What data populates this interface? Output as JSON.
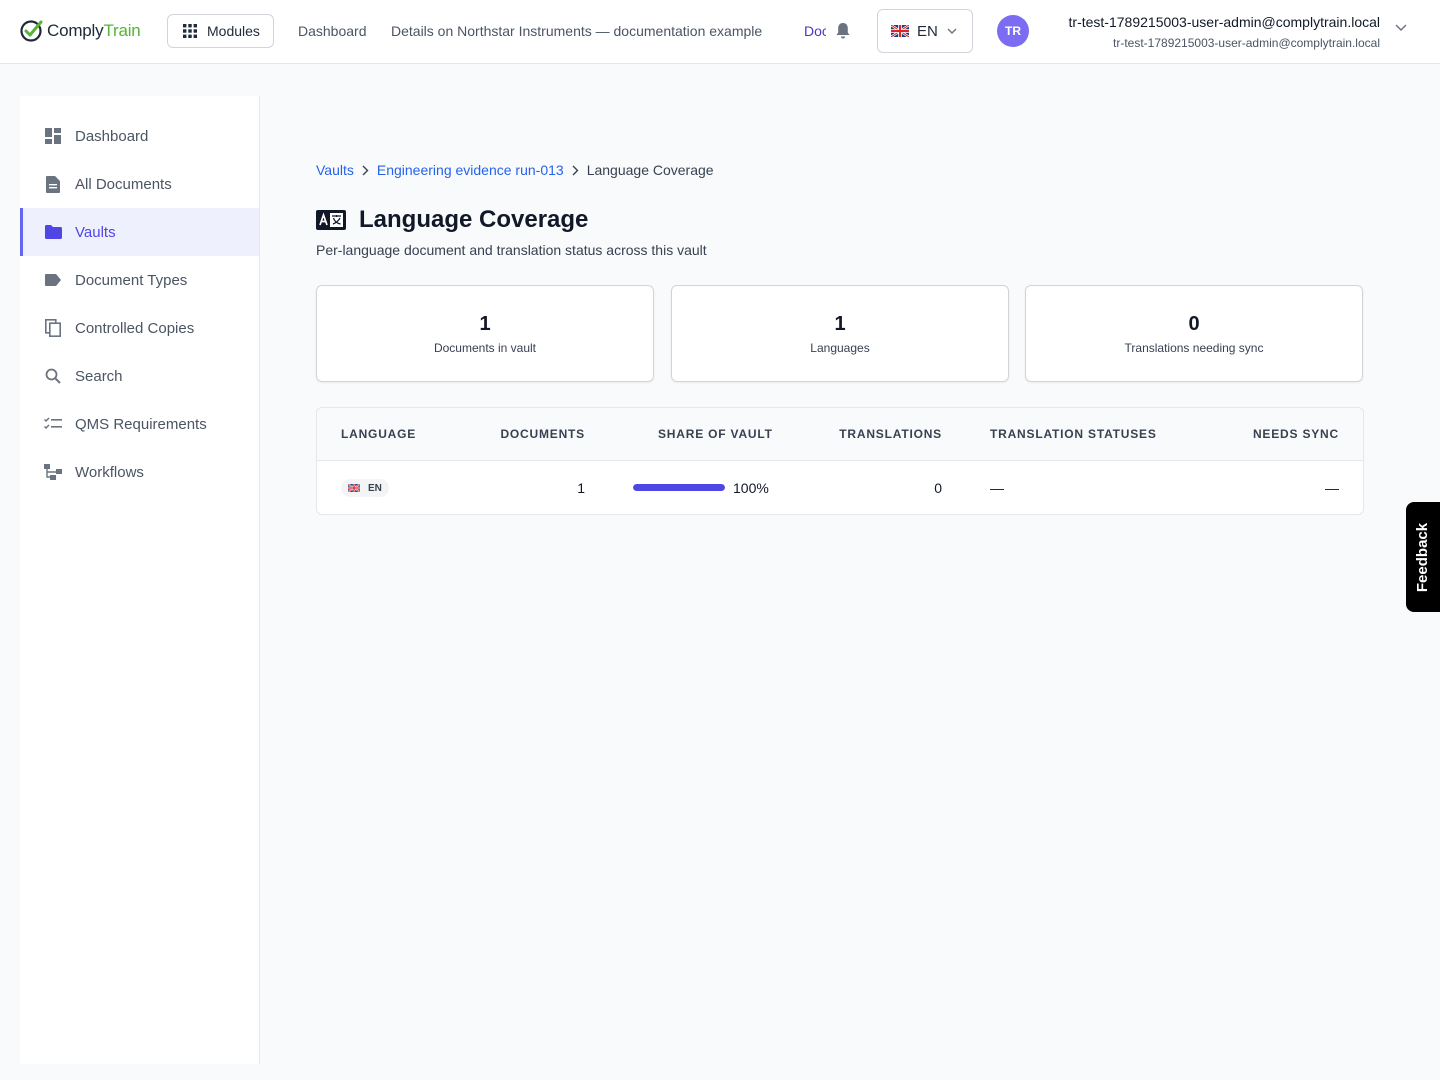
{
  "app": {
    "brand_part1": "Comply",
    "brand_part2": "Train",
    "brand_color": "#55b435",
    "accent_color": "#4f46e5"
  },
  "topbar": {
    "modules_label": "Modules",
    "nav": [
      {
        "label": "Dashboard"
      },
      {
        "label": "Details on Northstar Instruments — documentation example"
      },
      {
        "label": "Documents",
        "active": true
      }
    ],
    "language_label": "EN",
    "language_flag": "uk-flag-icon",
    "user": {
      "initials": "TR",
      "name": "tr-test-1789215003-user-admin@complytrain.local",
      "email": "tr-test-1789215003-user-admin@complytrain.local"
    }
  },
  "sidebar": {
    "items": [
      {
        "label": "Dashboard",
        "icon": "dashboard-icon"
      },
      {
        "label": "All Documents",
        "icon": "document-icon"
      },
      {
        "label": "Vaults",
        "icon": "folder-icon",
        "active": true
      },
      {
        "label": "Document Types",
        "icon": "tag-icon"
      },
      {
        "label": "Controlled Copies",
        "icon": "copy-icon"
      },
      {
        "label": "Search",
        "icon": "search-icon"
      },
      {
        "label": "QMS Requirements",
        "icon": "checklist-icon"
      },
      {
        "label": "Workflows",
        "icon": "workflow-icon"
      }
    ]
  },
  "breadcrumb": {
    "items": [
      "Vaults",
      "Engineering evidence run-013"
    ],
    "current": "Language Coverage"
  },
  "page": {
    "title": "Language Coverage",
    "subtitle": "Per-language document and translation status across this vault",
    "title_icon": "translate-icon"
  },
  "stats": [
    {
      "value": "1",
      "label": "Documents in vault"
    },
    {
      "value": "1",
      "label": "Languages"
    },
    {
      "value": "0",
      "label": "Translations needing sync"
    }
  ],
  "table": {
    "columns": [
      "LANGUAGE",
      "DOCUMENTS",
      "SHARE OF VAULT",
      "TRANSLATIONS",
      "TRANSLATION STATUSES",
      "NEEDS SYNC"
    ],
    "rows": [
      {
        "language": "EN",
        "language_flag": "uk-flag-icon",
        "documents": "1",
        "share": 1.0,
        "share_label": "100%",
        "translations": "0",
        "translation_statuses": "—",
        "needs_sync": "—"
      }
    ]
  },
  "feedback_label": "Feedback"
}
